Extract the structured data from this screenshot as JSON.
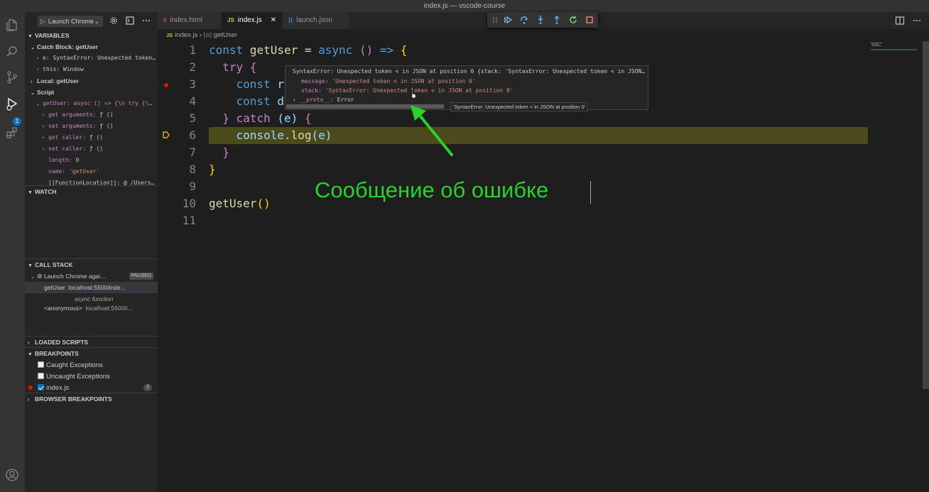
{
  "window": {
    "title": "index.js — vscode-course"
  },
  "activity_bar": {
    "debug_badge": "1"
  },
  "sidebar": {
    "launch_config": "Launch Chrome",
    "variables": {
      "header": "VARIABLES",
      "catch_block": "Catch Block: getUser",
      "e_row": "e: SyntaxError: Unexpected token…",
      "this_row_key": "this:",
      "this_row_val": "Window",
      "local": "Local: getUser",
      "script": "Script",
      "getuser_row": "getUser: async () => {\\n  try {\\…",
      "get_arguments": "get arguments:",
      "set_arguments": "set arguments:",
      "get_caller": "get caller:",
      "set_caller": "set caller:",
      "fn_val": "ƒ ()",
      "length_key": "length:",
      "length_val": "0",
      "name_key": "name:",
      "name_val": "'getUser'",
      "fl_row": "[[FunctionLocation]]: @ /Users…"
    },
    "watch": {
      "header": "WATCH"
    },
    "call_stack": {
      "header": "CALL STACK",
      "session": "Launch Chrome agai…",
      "status": "PAUSED",
      "frames": [
        {
          "name": "getUser",
          "loc": "localhost:5500/inde…"
        },
        {
          "name": "async function",
          "loc": ""
        },
        {
          "name": "<anonymous>",
          "loc": "localhost:5500/i…"
        }
      ]
    },
    "loaded_scripts": {
      "header": "LOADED SCRIPTS"
    },
    "breakpoints": {
      "header": "BREAKPOINTS",
      "caught": "Caught Exceptions",
      "uncaught": "Uncaught Exceptions",
      "file": "index.js",
      "file_count": "3"
    },
    "browser_breakpoints": {
      "header": "BROWSER BREAKPOINTS"
    }
  },
  "tabs": [
    {
      "label": "index.html",
      "icon": "html5-icon"
    },
    {
      "label": "index.js",
      "icon": "js-icon",
      "active": true
    },
    {
      "label": "launch.json",
      "icon": "vscode-icon"
    }
  ],
  "breadcrumbs": {
    "file": "index.js",
    "symbol": "getUser",
    "js_badge": "JS"
  },
  "editor": {
    "line_numbers": [
      "1",
      "2",
      "3",
      "4",
      "5",
      "6",
      "7",
      "8",
      "9",
      "10",
      "11"
    ],
    "code": {
      "l1": {
        "a": "const",
        "b": " getUser ",
        "c": "=",
        "d": " async ",
        "e": "()",
        "f": " => ",
        "g": "{"
      },
      "l2": {
        "a": "  try",
        "b": " {"
      },
      "l3": {
        "a": "    const",
        "b": " r"
      },
      "l4": {
        "a": "    const",
        "b": " d"
      },
      "l5": {
        "a": "  }",
        "b": " catch",
        "c": " (e) ",
        "d": "{"
      },
      "l6": {
        "a": "    console",
        "b": ".",
        "c": "log",
        "d": "(e)"
      },
      "l7": {
        "a": "  }"
      },
      "l8": {
        "a": "}"
      },
      "l10": {
        "a": "getUser",
        "b": "()"
      }
    },
    "hover": {
      "line1": "SyntaxError: Unexpected token < in JSON at position 0 {stack: 'SyntaxError: Unexpected token < in JSON…",
      "message_key": "message:",
      "message_val": "'Unexpected token < in JSON at position 0'",
      "stack_key": "stack:",
      "stack_val": "'SyntaxError: Unexpected token < in JSON at position 0'",
      "proto_key": "__proto__:",
      "proto_val": "Error",
      "tooltip": "'SyntaxError: Unexpected token < in JSON at position 0'"
    },
    "annotation": "Сообщение об ошибке"
  },
  "colors": {
    "annotation": "#2bd02b",
    "highlight": "#4b4a1c",
    "breakpoint": "#e51400",
    "accent": "#0e70c0"
  }
}
